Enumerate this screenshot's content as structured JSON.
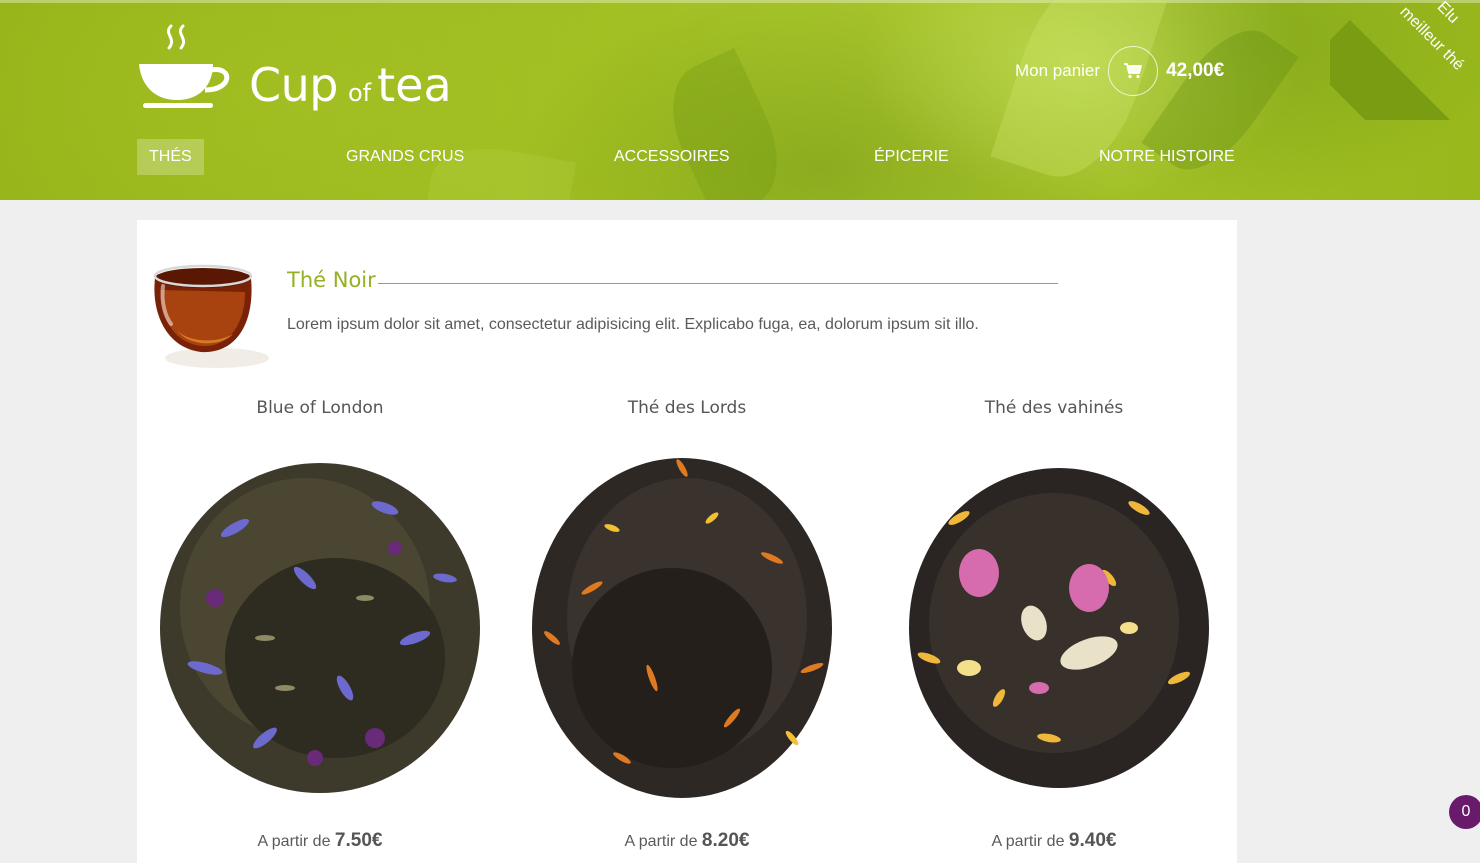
{
  "brand": {
    "word1": "Cup",
    "word2": "of",
    "word3": "tea"
  },
  "cart": {
    "label": "Mon panier",
    "total": "42,00€",
    "icon": "cart-icon"
  },
  "ribbon": {
    "line1": "Elu",
    "line2": "meilleur thé"
  },
  "nav": [
    {
      "label": "Thés",
      "active": true
    },
    {
      "label": "Grands crus",
      "active": false
    },
    {
      "label": "Accessoires",
      "active": false
    },
    {
      "label": "Épicerie",
      "active": false
    },
    {
      "label": "Notre histoire",
      "active": false
    }
  ],
  "category": {
    "title": "Thé Noir",
    "description": "Lorem ipsum dolor sit amet, consectetur adipisicing elit. Explicabo fuga, ea, dolorum ipsum sit illo."
  },
  "products": [
    {
      "name": "Blue of London",
      "price_prefix": "A partir de",
      "price": "7.50€"
    },
    {
      "name": "Thé des Lords",
      "price_prefix": "A partir de",
      "price": "8.20€"
    },
    {
      "name": "Thé des vahinés",
      "price_prefix": "A partir de",
      "price": "9.40€"
    }
  ],
  "badge": {
    "count": "0"
  }
}
